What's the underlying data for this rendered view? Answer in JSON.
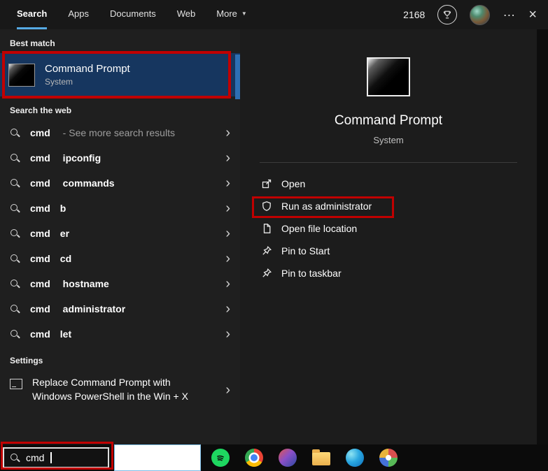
{
  "colors": {
    "accent_blue": "#55a9e3",
    "best_match_highlight": "#16365f",
    "annotation_red": "#c00000",
    "panel_bg": "#1f1f1f",
    "taskbar_bg": "#0b0b0b"
  },
  "topbar": {
    "tabs": [
      {
        "label": "Search",
        "active": true
      },
      {
        "label": "Apps"
      },
      {
        "label": "Documents"
      },
      {
        "label": "Web"
      },
      {
        "label": "More",
        "dropdown": "▼"
      }
    ],
    "rewards_points": "2168",
    "ellipsis": "…",
    "close": "×"
  },
  "left_panel": {
    "best_match_header": "Best match",
    "best_match": {
      "title": "Command Prompt",
      "subtitle": "System",
      "icon": "command-prompt-icon"
    },
    "web_header": "Search the web",
    "suggestions": [
      {
        "base": "cmd",
        "rest": " - See more search results",
        "muted": true
      },
      {
        "base": "cmd",
        "rest": " ipconfig"
      },
      {
        "base": "cmd",
        "rest": " commands"
      },
      {
        "base": "cmd",
        "rest": "b"
      },
      {
        "base": "cmd",
        "rest": "er"
      },
      {
        "base": "cmd",
        "rest": "cd"
      },
      {
        "base": "cmd",
        "rest": " hostname"
      },
      {
        "base": "cmd",
        "rest": " administrator"
      },
      {
        "base": "cmd",
        "rest": "let"
      }
    ],
    "settings_header": "Settings",
    "settings_item": {
      "line1": "Replace Command Prompt with",
      "line2": "Windows PowerShell in the Win + X",
      "icon": "console-window-icon"
    }
  },
  "preview": {
    "title": "Command Prompt",
    "subtitle": "System",
    "icon": "command-prompt-icon-large",
    "actions": [
      {
        "label": "Open",
        "icon": "open-icon"
      },
      {
        "label": "Run as administrator",
        "icon": "shield-icon",
        "highlighted": true
      },
      {
        "label": "Open file location",
        "icon": "file-location-icon"
      },
      {
        "label": "Pin to Start",
        "icon": "pin-icon"
      },
      {
        "label": "Pin to taskbar",
        "icon": "pin-icon"
      }
    ]
  },
  "taskbar": {
    "search_value": "cmd",
    "icons": [
      "spotify-icon",
      "chrome-icon",
      "app-icon-3",
      "file-explorer-icon",
      "edge-icon",
      "app-icon-6"
    ]
  }
}
